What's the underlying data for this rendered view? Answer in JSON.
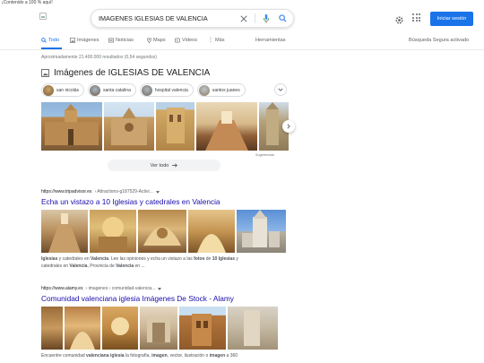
{
  "top_note": "¡Contenido a 100 % aquí!",
  "search": {
    "query": "IMAGENES IGLESIAS DE VALENCIA"
  },
  "header": {
    "signin_label": "Iniciar sesión"
  },
  "tabs": [
    {
      "label": "Todo",
      "icon": "search-icon"
    },
    {
      "label": "Imágenes",
      "icon": "image-icon"
    },
    {
      "label": "Noticias",
      "icon": "news-icon"
    },
    {
      "label": "Maps",
      "icon": "map-pin-icon"
    },
    {
      "label": "Videos",
      "icon": "video-icon"
    },
    {
      "label": "Más",
      "icon": "more-icon"
    },
    {
      "label": "Herramientas"
    },
    {
      "label": "Búsqueda Segura activado"
    }
  ],
  "stats": "Aproximadamente 21.400.000 resultados (0,54 segundos)",
  "images_section": {
    "title": "Imágenes de IGLESIAS DE VALENCIA",
    "chips": [
      "san nicolás",
      "santa catalina",
      "hospital valencia",
      "santos juanes"
    ],
    "suggest_label": "Sugerencias",
    "see_all": "Ver todo"
  },
  "results": [
    {
      "url_domain": "https://www.tripadvisor.es",
      "url_path": " › Attractions-g187529-Activi...",
      "title": "Echa un vistazo a 10 Iglesias y catedrales en Valencia",
      "snippet_parts": [
        "Iglesias",
        " y catedrales en ",
        "Valencia",
        ". Lee las opiniones y echa un vistazo a las ",
        "fotos",
        " de ",
        "10 Iglesias",
        " y",
        "catedrales en ",
        "Valencia",
        ", Provincia de ",
        "Valencia",
        " en ..."
      ]
    },
    {
      "url_domain": "https://www.alamy.es",
      "url_path": " › imagenes › comunidad-valencia...",
      "title": "Comunidad valenciana iglesia Imágenes De Stock - Alamy",
      "snippet_parts": [
        "Encuentre comunidad ",
        "valenciana iglesia",
        " la fotografía, ",
        "imagen",
        ", vector, ilustración o ",
        "imagen",
        " a 360"
      ]
    }
  ],
  "colors": {
    "accent": "#1a73e8",
    "link": "#1a0dab",
    "muted": "#70757a"
  }
}
